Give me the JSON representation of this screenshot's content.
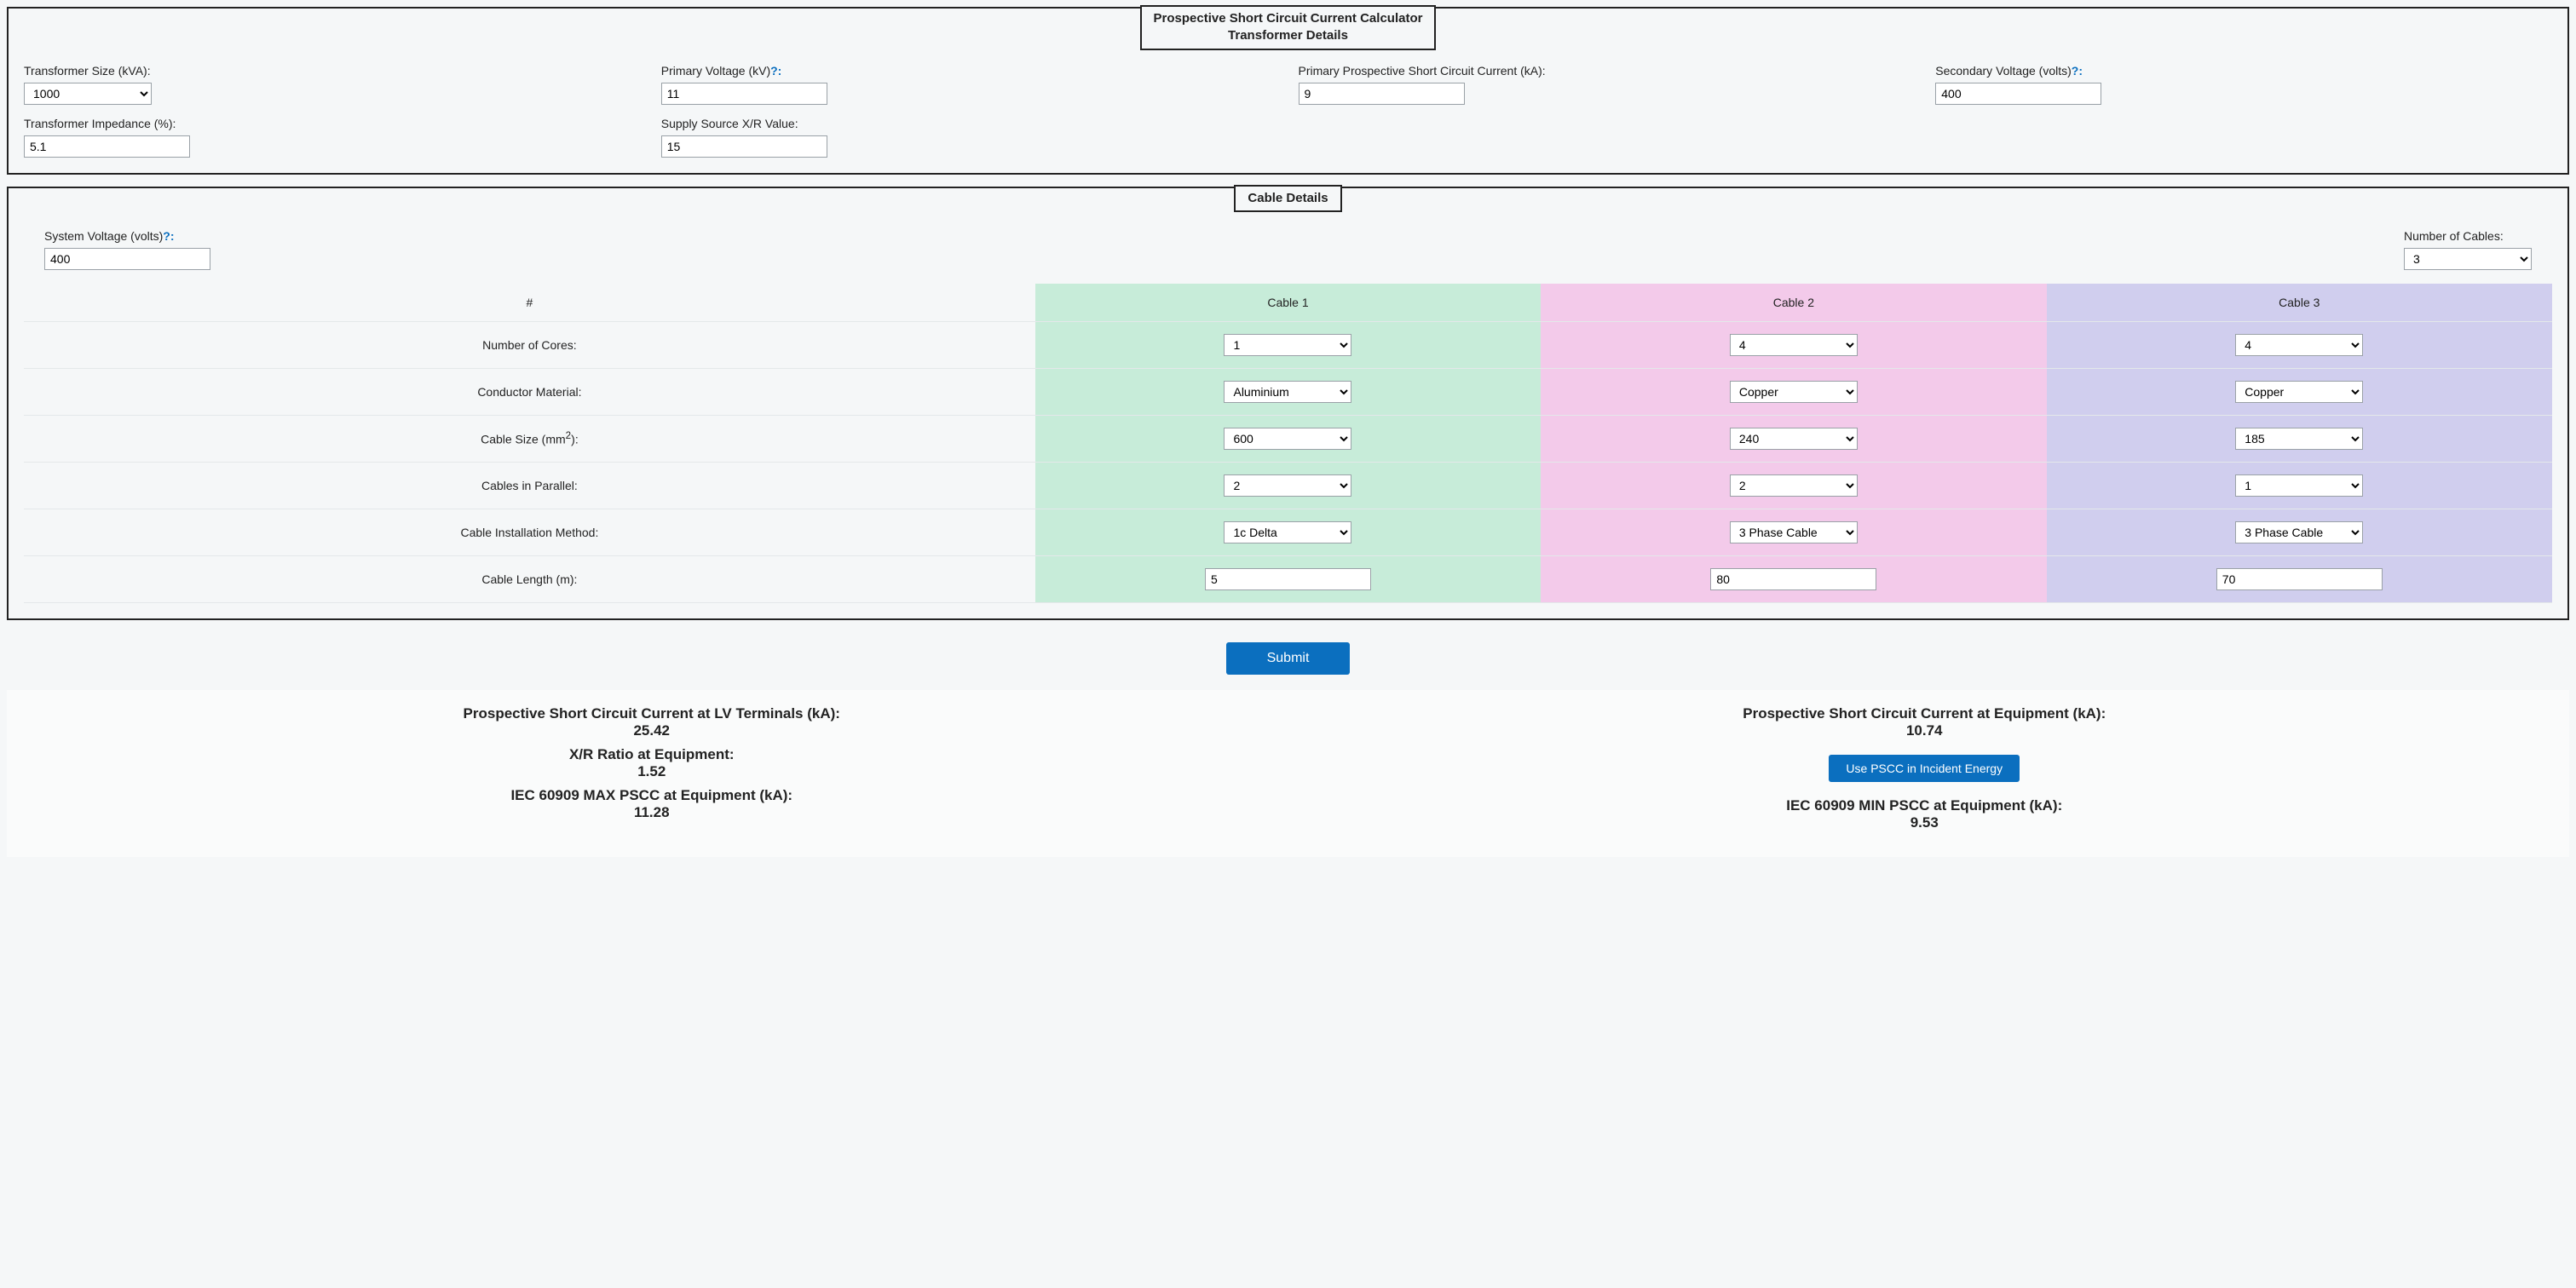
{
  "transformer": {
    "title_line1": "Prospective Short Circuit Current Calculator",
    "title_line2": "Transformer Details",
    "fields": {
      "size_label": "Transformer Size (kVA):",
      "size_value": "1000",
      "primary_v_label": "Primary Voltage (kV)",
      "primary_v_value": "11",
      "primary_pscc_label": "Primary Prospective Short Circuit Current (kA):",
      "primary_pscc_value": "9",
      "secondary_v_label": "Secondary Voltage (volts)",
      "secondary_v_value": "400",
      "impedance_label": "Transformer Impedance (%):",
      "impedance_value": "5.1",
      "xr_label": "Supply Source X/R Value:",
      "xr_value": "15",
      "help_q": "?:"
    }
  },
  "cable": {
    "title": "Cable Details",
    "system_v_label": "System Voltage (volts)",
    "system_v_value": "400",
    "num_cables_label": "Number of Cables:",
    "num_cables_value": "3",
    "hash": "#",
    "headers": [
      "Cable 1",
      "Cable 2",
      "Cable 3"
    ],
    "rows": {
      "cores": {
        "label": "Number of Cores:",
        "v": [
          "1",
          "4",
          "4"
        ]
      },
      "material": {
        "label": "Conductor Material:",
        "v": [
          "Aluminium",
          "Copper",
          "Copper"
        ]
      },
      "size": {
        "label_pre": "Cable Size (mm",
        "label_post": "):",
        "v": [
          "600",
          "240",
          "185"
        ]
      },
      "parallel": {
        "label": "Cables in Parallel:",
        "v": [
          "2",
          "2",
          "1"
        ]
      },
      "install": {
        "label": "Cable Installation Method:",
        "v": [
          "1c Delta",
          "3 Phase Cable",
          "3 Phase Cable"
        ]
      },
      "length": {
        "label": "Cable Length (m):",
        "v": [
          "5",
          "80",
          "70"
        ]
      }
    }
  },
  "buttons": {
    "submit": "Submit",
    "use_pscc": "Use PSCC in Incident Energy"
  },
  "results": {
    "lv_label": "Prospective Short Circuit Current at LV Terminals (kA):",
    "lv_value": "25.42",
    "eq_label": "Prospective Short Circuit Current at Equipment (kA):",
    "eq_value": "10.74",
    "xr_label": "X/R Ratio at Equipment:",
    "xr_value": "1.52",
    "max_label": "IEC 60909 MAX PSCC at Equipment (kA):",
    "max_value": "11.28",
    "min_label": "IEC 60909 MIN PSCC at Equipment (kA):",
    "min_value": "9.53"
  }
}
